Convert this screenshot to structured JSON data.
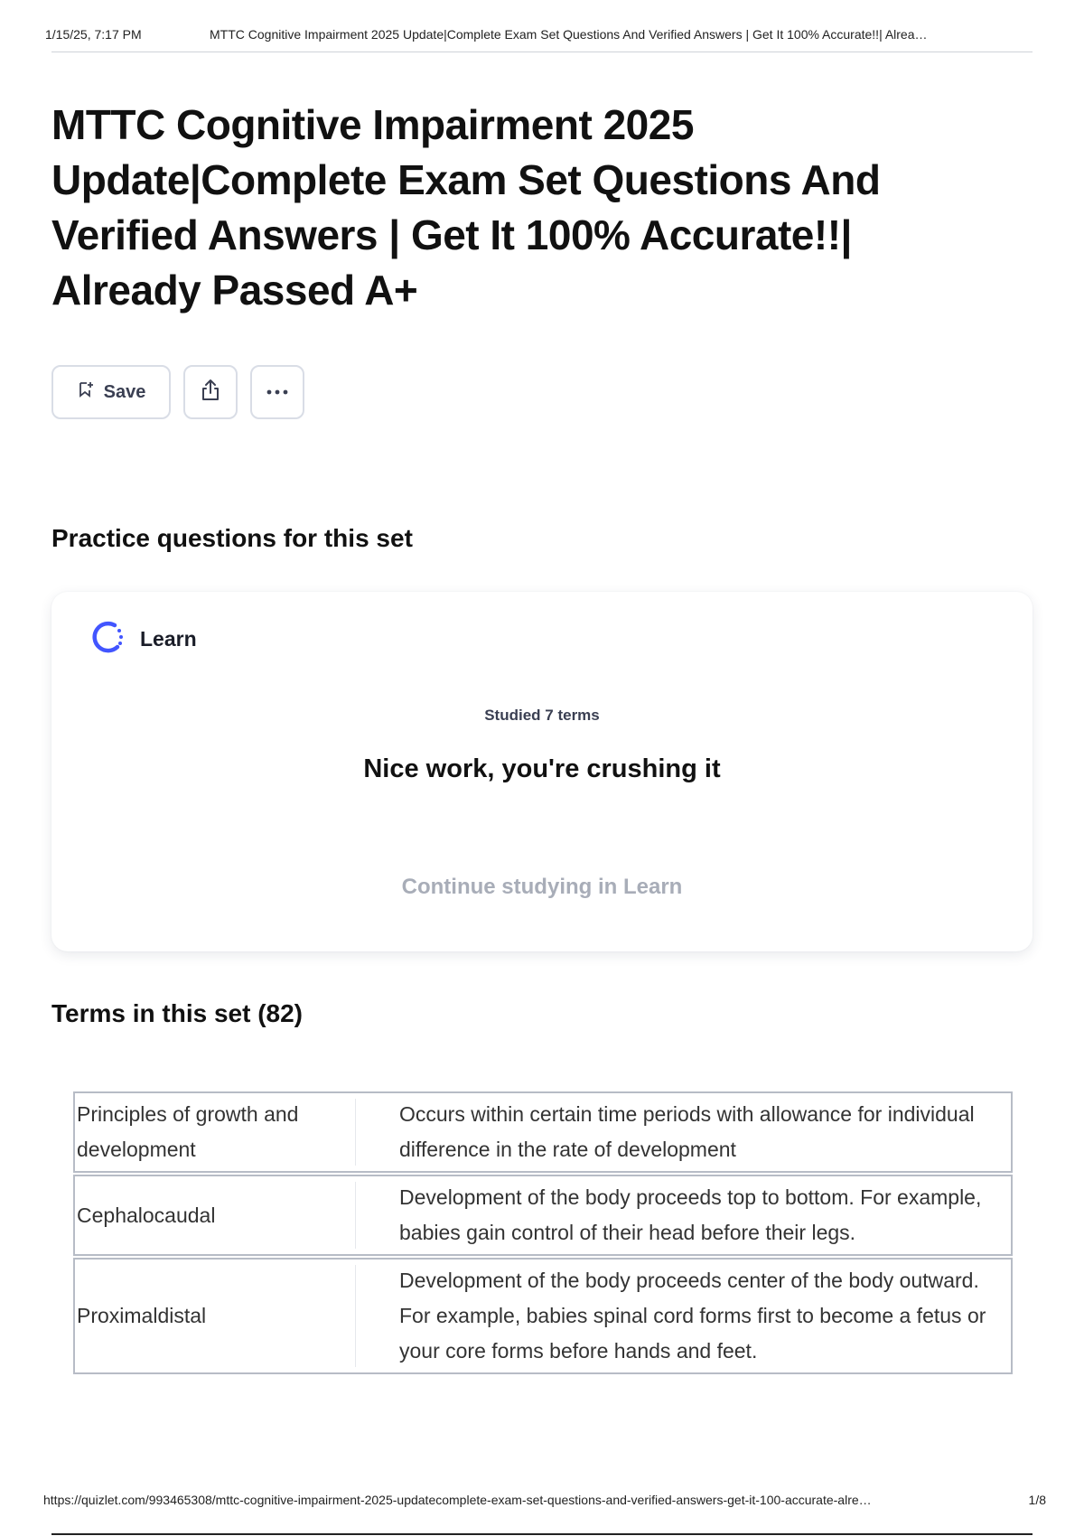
{
  "print_header": {
    "timestamp": "1/15/25, 7:17 PM",
    "doc_title": "MTTC Cognitive Impairment 2025 Update|Complete Exam Set Questions And Verified Answers | Get It 100% Accurate!!| Alrea…"
  },
  "title": "MTTC Cognitive Impairment 2025 Update|Complete Exam Set Questions And Verified Answers | Get It 100% Accurate!!| Already Passed A+",
  "actions": {
    "save_label": "Save",
    "save_icon": "bookmark-add-icon",
    "share_icon": "share-icon",
    "more_icon": "more-options-icon"
  },
  "practice": {
    "heading": "Practice questions for this set",
    "mode_label": "Learn",
    "mode_icon": "learn-progress-icon",
    "studied_text": "Studied 7 terms",
    "encouragement": "Nice work, you're crushing it",
    "continue_label": "Continue studying in Learn"
  },
  "terms": {
    "heading": "Terms in this set (82)",
    "items": [
      {
        "term": "Principles of growth and development",
        "definition": "Occurs within certain time periods with allowance for individual difference in the rate of development"
      },
      {
        "term": "Cephalocaudal",
        "definition": "Development of the body proceeds top to bottom. For example, babies gain control of their head before their legs."
      },
      {
        "term": "Proximaldistal",
        "definition": "Development of the body proceeds center of the body outward. For example, babies spinal cord forms first to become a fetus or your core forms before hands and feet."
      }
    ]
  },
  "print_footer": {
    "url": "https://quizlet.com/993465308/mttc-cognitive-impairment-2025-updatecomplete-exam-set-questions-and-verified-answers-get-it-100-accurate-alre…",
    "page": "1/8"
  },
  "colors": {
    "learn_accent": "#4255ff",
    "muted_text": "#a8adb8",
    "button_border": "#d9dde6"
  }
}
